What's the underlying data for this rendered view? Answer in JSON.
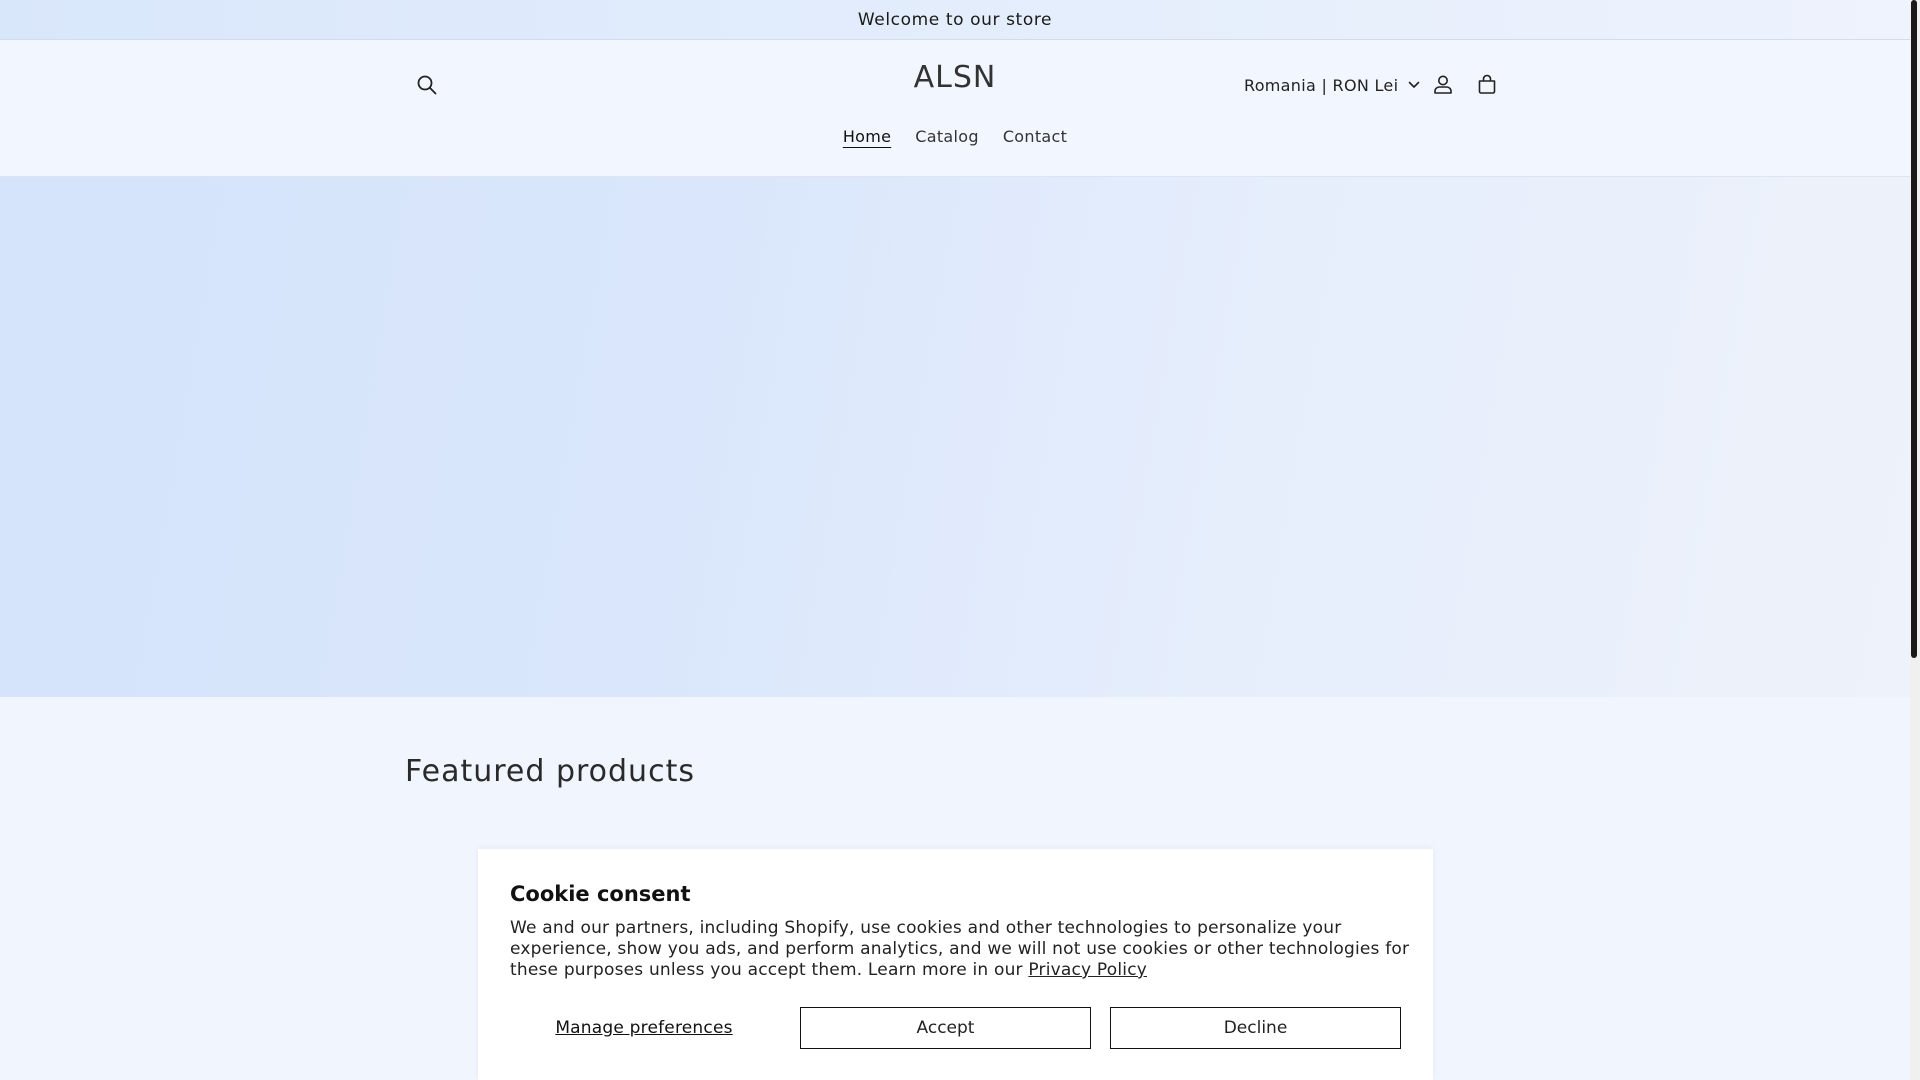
{
  "announcement": {
    "text": "Welcome to our store"
  },
  "header": {
    "logo": "ALSN",
    "country_selector": "Romania | RON Lei",
    "nav": [
      {
        "label": "Home",
        "active": true
      },
      {
        "label": "Catalog",
        "active": false
      },
      {
        "label": "Contact",
        "active": false
      }
    ],
    "icons": {
      "search": "search-icon",
      "account": "account-icon",
      "cart": "cart-icon",
      "dropdown": "chevron-down-icon"
    }
  },
  "featured": {
    "title": "Featured products"
  },
  "cookie": {
    "title": "Cookie consent",
    "body": "We and our partners, including Shopify, use cookies and other technologies to personalize your experience, show you ads, and perform analytics, and we will not use cookies or other technologies for these purposes unless you accept them. Learn more in our ",
    "privacy_link": "Privacy Policy",
    "manage_label": "Manage preferences",
    "accept_label": "Accept",
    "decline_label": "Decline"
  },
  "colors": {
    "background": "#f0f5fe",
    "hero_start": "#d5e4fb",
    "hero_end": "#eef2fa",
    "text": "#222222"
  }
}
